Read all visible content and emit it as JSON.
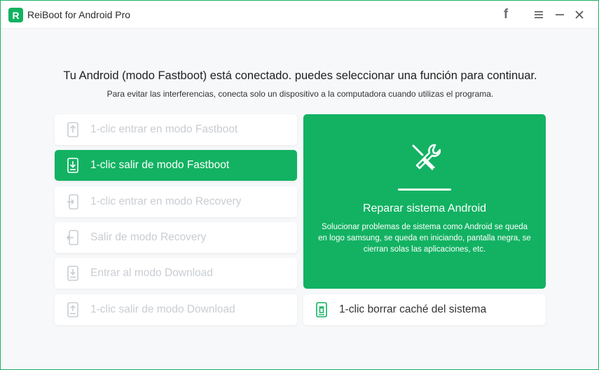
{
  "app": {
    "logo_letter": "R",
    "title": "ReiBoot for Android Pro"
  },
  "window_controls": {
    "facebook_glyph": "f"
  },
  "header": {
    "headline": "Tu Android (modo Fastboot) está conectado. puedes seleccionar una función para continuar.",
    "subline": "Para evitar las interferencias, conecta solo un dispositivo a la computadora cuando utilizas el programa."
  },
  "options": [
    {
      "label": "1-clic entrar en modo Fastboot",
      "icon": "phone-arrow-up-icon",
      "state": "disabled"
    },
    {
      "label": "1-clic salir de modo Fastboot",
      "icon": "phone-arrow-down-icon",
      "state": "active"
    },
    {
      "label": "1-clic entrar en modo Recovery",
      "icon": "phone-enter-icon",
      "state": "disabled"
    },
    {
      "label": "Salir de modo Recovery",
      "icon": "phone-exit-icon",
      "state": "disabled"
    },
    {
      "label": "Entrar al modo Download",
      "icon": "phone-download-icon",
      "state": "disabled"
    },
    {
      "label": "1-clic salir de modo Download",
      "icon": "phone-upload-icon",
      "state": "disabled"
    }
  ],
  "repair": {
    "title": "Reparar sistema Android",
    "description": "Solucionar problemas de sistema como Android se queda en logo samsung, se queda en iniciando, pantalla negra, se cierran solas las aplicaciones, etc.",
    "icon": "repair-tools-icon"
  },
  "cache": {
    "label": "1-clic borrar caché del sistema",
    "icon": "phone-trash-icon"
  },
  "colors": {
    "accent": "#12b262",
    "disabled_text": "#c9cdd2",
    "window_border": "#1db063"
  }
}
